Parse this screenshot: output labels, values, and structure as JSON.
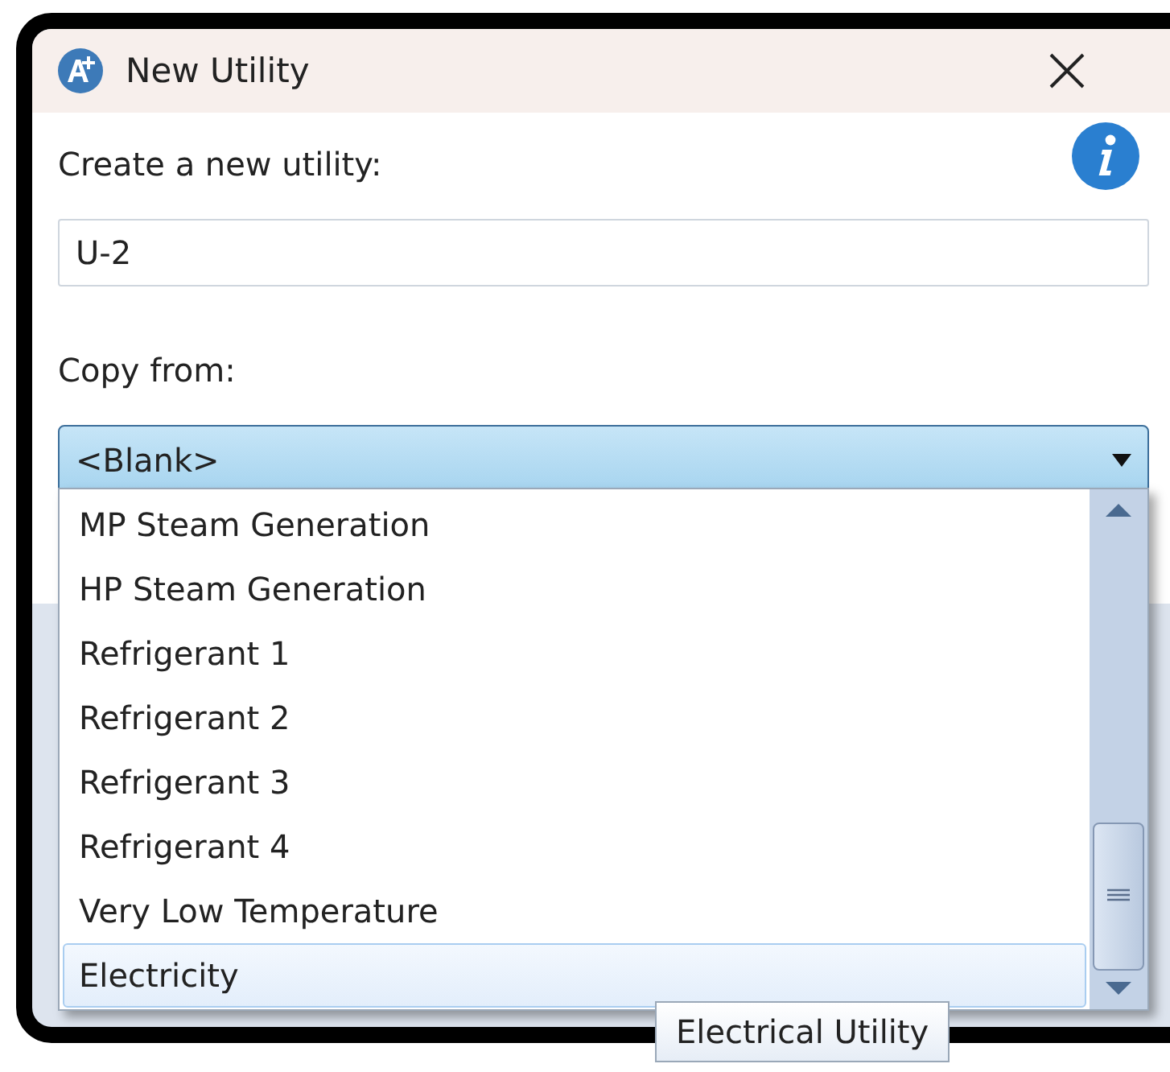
{
  "window": {
    "title": "New Utility"
  },
  "name_field": {
    "label": "Create a new utility:",
    "value": "U-2"
  },
  "copy_from": {
    "label": "Copy from:",
    "value": "<Blank>",
    "expanded": true,
    "options": [
      {
        "label": "MP Steam Generation",
        "selected": false
      },
      {
        "label": "HP Steam Generation",
        "selected": false
      },
      {
        "label": "Refrigerant 1",
        "selected": false
      },
      {
        "label": "Refrigerant 2",
        "selected": false
      },
      {
        "label": "Refrigerant 3",
        "selected": false
      },
      {
        "label": "Refrigerant 4",
        "selected": false
      },
      {
        "label": "Very Low Temperature",
        "selected": false
      },
      {
        "label": "Electricity",
        "selected": true
      }
    ]
  },
  "tooltip": "Electrical Utility"
}
